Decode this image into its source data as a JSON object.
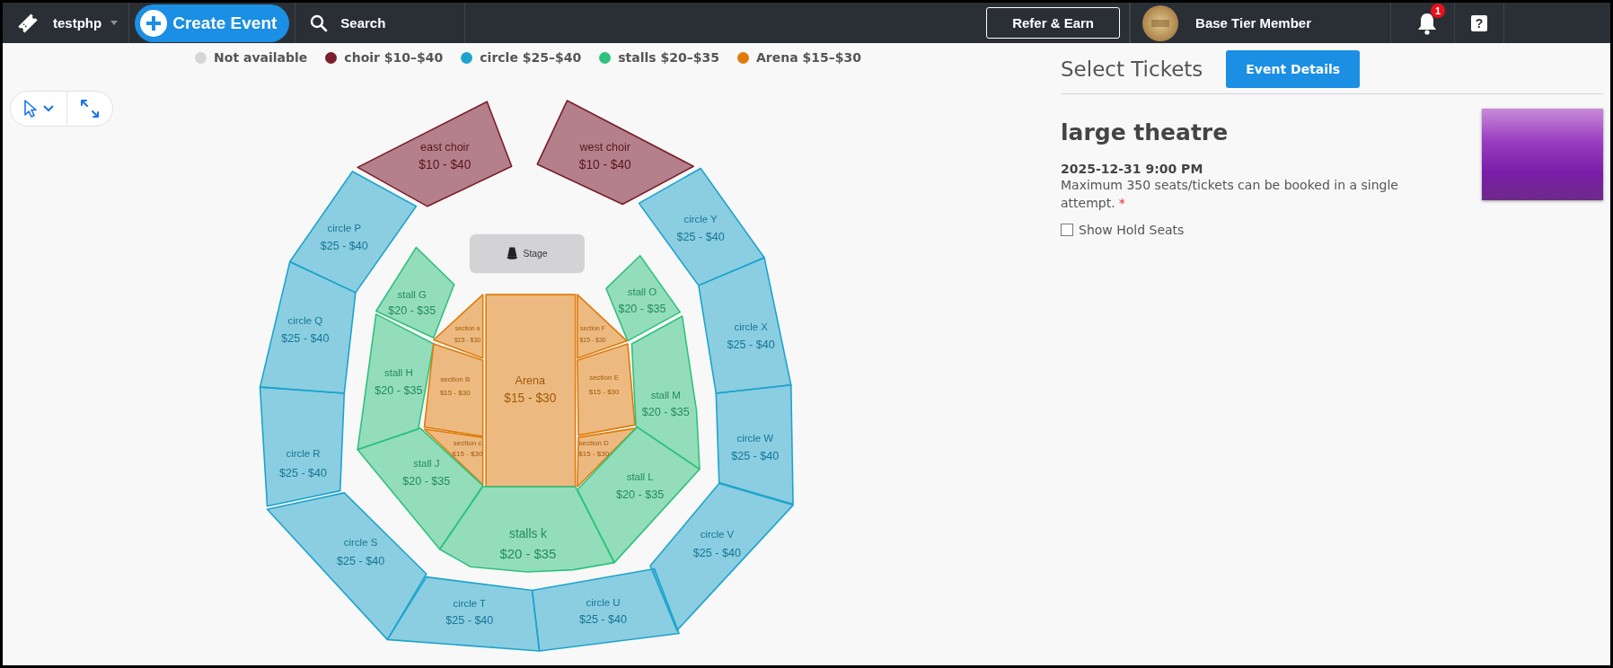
{
  "header": {
    "brand": "testphp",
    "create_button": "Create Event",
    "search": "Search",
    "refer_button": "Refer & Earn",
    "member": "Base Tier Member",
    "notification_count": "1",
    "help": "?"
  },
  "legend": [
    {
      "label": "Not available",
      "color": "#d6d6d6",
      "kind": "unavailable"
    },
    {
      "label": "choir $10–$40",
      "color": "#7b1e2e",
      "kind": "choir"
    },
    {
      "label": "circle $25–$40",
      "color": "#1ea4cc",
      "kind": "circle"
    },
    {
      "label": "stalls $20–$35",
      "color": "#2fc27d",
      "kind": "stall"
    },
    {
      "label": "Arena $15–$30",
      "color": "#e07b0a",
      "kind": "arena"
    }
  ],
  "stage": {
    "label": "Stage"
  },
  "sections": [
    {
      "name": "east choir",
      "price": "$10 - $40",
      "kind": "choir"
    },
    {
      "name": "west choir",
      "price": "$10 - $40",
      "kind": "choir"
    },
    {
      "name": "circle P",
      "price": "$25 - $40",
      "kind": "circle"
    },
    {
      "name": "circle Y",
      "price": "$25 - $40",
      "kind": "circle"
    },
    {
      "name": "stall G",
      "price": "$20 - $35",
      "kind": "stall"
    },
    {
      "name": "stall O",
      "price": "$20 - $35",
      "kind": "stall"
    },
    {
      "name": "circle Q",
      "price": "$25 - $40",
      "kind": "circle"
    },
    {
      "name": "section a",
      "price": "$15 - $30",
      "kind": "arena"
    },
    {
      "name": "section F",
      "price": "$15 - $30",
      "kind": "arena"
    },
    {
      "name": "circle X",
      "price": "$25 - $40",
      "kind": "circle"
    },
    {
      "name": "stall H",
      "price": "$20 - $35",
      "kind": "stall"
    },
    {
      "name": "section B",
      "price": "$15 - $30",
      "kind": "arena"
    },
    {
      "name": "Arena",
      "price": "$15 - $30",
      "kind": "arena"
    },
    {
      "name": "section E",
      "price": "$15 - $30",
      "kind": "arena"
    },
    {
      "name": "stall M",
      "price": "$20 - $35",
      "kind": "stall"
    },
    {
      "name": "circle R",
      "price": "$25 - $40",
      "kind": "circle"
    },
    {
      "name": "section c",
      "price": "$15 - $30",
      "kind": "arena"
    },
    {
      "name": "section D",
      "price": "$15 - $30",
      "kind": "arena"
    },
    {
      "name": "circle W",
      "price": "$25 - $40",
      "kind": "circle"
    },
    {
      "name": "stall J",
      "price": "$20 - $35",
      "kind": "stall"
    },
    {
      "name": "stall L",
      "price": "$20 - $35",
      "kind": "stall"
    },
    {
      "name": "stalls k",
      "price": "$20 - $35",
      "kind": "stall"
    },
    {
      "name": "circle V",
      "price": "$25 - $40",
      "kind": "circle"
    },
    {
      "name": "circle S",
      "price": "$25 - $40",
      "kind": "circle"
    },
    {
      "name": "circle T",
      "price": "$25 - $40",
      "kind": "circle"
    },
    {
      "name": "circle U",
      "price": "$25 - $40",
      "kind": "circle"
    }
  ],
  "panel": {
    "title": "Select Tickets",
    "details_button": "Event Details",
    "event_name": "large theatre",
    "date": "2025-12-31 9:00 PM",
    "note": "Maximum 350 seats/tickets can be booked in a single attempt.",
    "required_mark": "*",
    "show_hold_seats": {
      "label": "Show Hold Seats",
      "checked": false
    }
  }
}
